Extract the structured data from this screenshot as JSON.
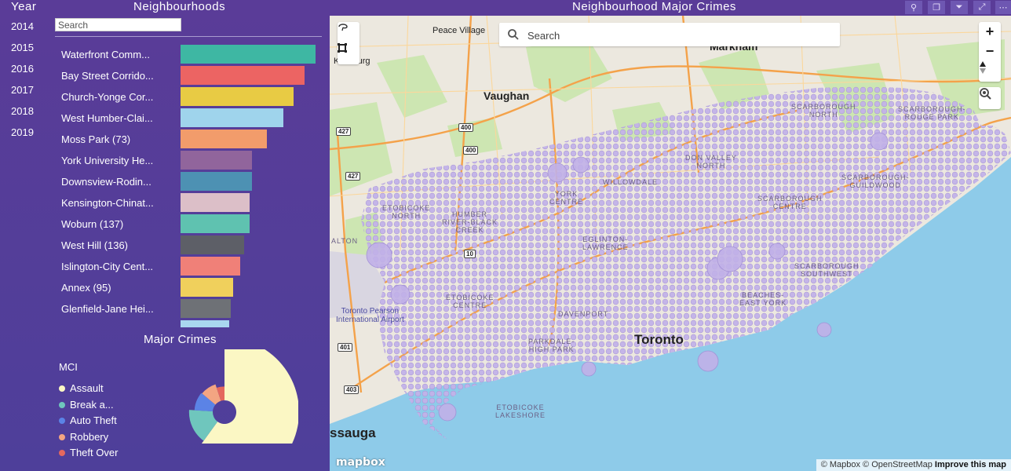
{
  "year_slicer": {
    "title": "Year",
    "years": [
      "2014",
      "2015",
      "2016",
      "2017",
      "2018",
      "2019"
    ]
  },
  "neighbourhoods": {
    "title": "Neighbourhoods",
    "search_placeholder": "Search",
    "items": [
      {
        "label": "Waterfront Comm...",
        "value": 1.0,
        "color": "#3eb7a3"
      },
      {
        "label": "Bay Street Corrido...",
        "value": 0.92,
        "color": "#ec6463"
      },
      {
        "label": "Church-Yonge Cor...",
        "value": 0.84,
        "color": "#e8cb44"
      },
      {
        "label": "West Humber-Clai...",
        "value": 0.76,
        "color": "#9fd4ec"
      },
      {
        "label": "Moss Park (73)",
        "value": 0.64,
        "color": "#f29c6b"
      },
      {
        "label": "York University He...",
        "value": 0.53,
        "color": "#91659c"
      },
      {
        "label": "Downsview-Rodin...",
        "value": 0.53,
        "color": "#4d91b3"
      },
      {
        "label": "Kensington-Chinat...",
        "value": 0.51,
        "color": "#dcbfc8"
      },
      {
        "label": "Woburn (137)",
        "value": 0.51,
        "color": "#5fc2b0"
      },
      {
        "label": "West Hill (136)",
        "value": 0.47,
        "color": "#5d5f67"
      },
      {
        "label": "Islington-City Cent...",
        "value": 0.44,
        "color": "#f08078"
      },
      {
        "label": "Annex (95)",
        "value": 0.39,
        "color": "#f0d05c"
      },
      {
        "label": "Glenfield-Jane Hei...",
        "value": 0.37,
        "color": "#6e7176"
      },
      {
        "label": "",
        "value": 0.36,
        "color": "#a9d6ef"
      }
    ]
  },
  "major_crimes": {
    "title": "Major Crimes",
    "legend_title": "MCI",
    "items": [
      {
        "label": "Assault",
        "share": 0.6,
        "color": "#fbf7c4"
      },
      {
        "label": "Break a...",
        "share": 0.16,
        "color": "#6fc6bd"
      },
      {
        "label": "Auto Theft",
        "share": 0.1,
        "color": "#5b83e6"
      },
      {
        "label": "Robbery",
        "share": 0.09,
        "color": "#f3a582"
      },
      {
        "label": "Theft Over",
        "share": 0.05,
        "color": "#e4685e"
      }
    ]
  },
  "map": {
    "title": "Neighbourhood Major Crimes",
    "search_placeholder": "Search",
    "attribution_prefix": "© Mapbox © OpenStreetMap",
    "attribution_link": "Improve this map",
    "logo": "mapbox",
    "zoom_in": "+",
    "zoom_out": "−",
    "places": {
      "peace_village": "Peace Village",
      "markham": "Markham",
      "kleinburg": "Kleinburg",
      "vaughan": "Vaughan",
      "toronto": "Toronto",
      "saugа": "ssauga",
      "alton": "ALTON",
      "airport": "Toronto Pearson\nInternational Airport",
      "scarborough_north": "SCARBOROUGH\nNORTH",
      "scarborough_rouge": "SCARBOROUGH-\nROUGE PARK",
      "scarborough_guildwood": "SCARBOROUGH-\nGUILDWOOD",
      "scarborough_centre": "SCARBOROUGH\nCENTRE",
      "scarborough_southwest": "SCARBOROUGH\nSOUTHWEST",
      "don_valley_north": "DON VALLEY\nNORTH",
      "willowdale": "WILLOWDALE",
      "york_centre": "YORK\nCENTRE",
      "etobicoke_north": "ETOBICOKE\nNORTH",
      "humber_river": "HUMBER\nRIVER-BLACK\nCREEK",
      "eglinton": "EGLINTON-\nLAWRENCE",
      "etobicoke_centre": "ETOBICOKE\nCENTRE",
      "davenport": "DAVENPORT",
      "beaches": "BEACHES-\nEAST YORK",
      "parkdale": "PARKDALE-\nHIGH PARK",
      "etobicoke_lakeshore": "ETOBICOKE\nLAKESHORE"
    },
    "shields": [
      "427",
      "400",
      "400",
      "427",
      "401",
      "403",
      "10"
    ]
  }
}
